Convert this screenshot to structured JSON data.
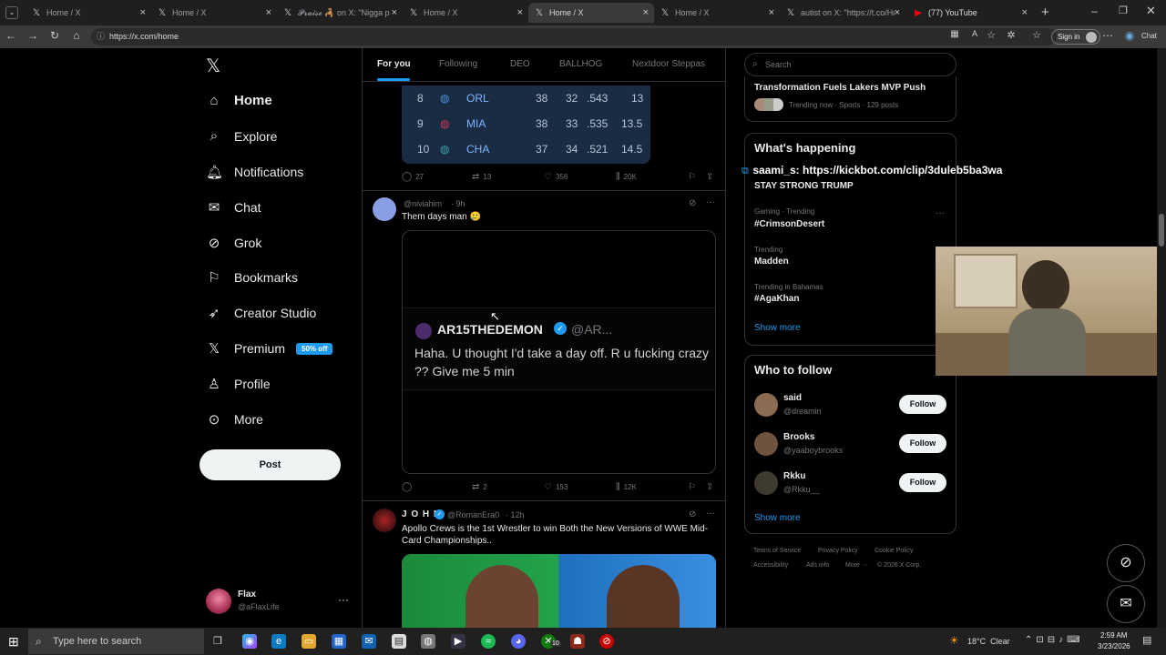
{
  "browser": {
    "tabs": [
      {
        "title": "Home / X",
        "icon": "x-logo-icon"
      },
      {
        "title": "Home / X",
        "icon": "x-logo-icon"
      },
      {
        "title": "𝓟𝓻𝓪𝓲𝓼𝓮 🦂 on X: \"Nigga p",
        "icon": "x-logo-icon"
      },
      {
        "title": "Home / X",
        "icon": "x-logo-icon"
      },
      {
        "title": "Home / X",
        "icon": "x-logo-icon"
      },
      {
        "title": "Home / X",
        "icon": "x-logo-icon"
      },
      {
        "title": "autist on X: \"https://t.co/Hc",
        "icon": "x-logo-icon"
      },
      {
        "title": "(77) YouTube",
        "icon": "youtube-icon"
      }
    ],
    "url": "https://x.com/home",
    "signin_label": "Sign in",
    "chat_label": "Chat"
  },
  "sidebar": {
    "logo": "𝕏",
    "items": [
      {
        "label": "Home",
        "icon": "home-icon"
      },
      {
        "label": "Explore",
        "icon": "search-icon"
      },
      {
        "label": "Notifications",
        "icon": "bell-icon"
      },
      {
        "label": "Chat",
        "icon": "mail-icon"
      },
      {
        "label": "Grok",
        "icon": "grok-icon"
      },
      {
        "label": "Bookmarks",
        "icon": "bookmark-icon"
      },
      {
        "label": "Creator Studio",
        "icon": "rocket-icon"
      },
      {
        "label": "Premium",
        "icon": "x-logo-icon"
      },
      {
        "label": "Profile",
        "icon": "person-icon"
      },
      {
        "label": "More",
        "icon": "more-circle-icon"
      }
    ],
    "premium_badge": "50% off",
    "post_button": "Post",
    "account": {
      "name": "Flax",
      "handle": "@aFlaxLife"
    }
  },
  "feed": {
    "tabs": [
      "For you",
      "Following",
      "DEO",
      "BALLHOG",
      "Nextdoor Steppas"
    ],
    "standings": [
      {
        "rank": "8",
        "team": "ORL",
        "w": "38",
        "l": "32",
        "pct": ".543",
        "gb": "13"
      },
      {
        "rank": "9",
        "team": "MIA",
        "w": "38",
        "l": "33",
        "pct": ".535",
        "gb": "13.5"
      },
      {
        "rank": "10",
        "team": "CHA",
        "w": "37",
        "l": "34",
        "pct": ".521",
        "gb": "14.5"
      }
    ],
    "post1_actions": {
      "replies": "27",
      "reposts": "13",
      "likes": "356",
      "views": "20K"
    },
    "post2": {
      "handle": "@niviahim",
      "time": "· 9h",
      "text": "Them days man 🥲",
      "quote_name": "AR15THEDEMON",
      "quote_handle": "@AR...",
      "quote_text": "Haha. U thought I'd take a day off. R u fucking crazy ?? Give me 5 min",
      "replies": "",
      "reposts": "2",
      "likes": "153",
      "views": "12K"
    },
    "post3": {
      "name": "J O H N",
      "handle": "@RomanEra0",
      "time": "· 12h",
      "text": "Apollo Crews is the 1st Wrestler to win Both the New Versions of WWE Mid-Card Championships.."
    }
  },
  "right": {
    "search_placeholder": "Search",
    "top_trend_title": "Transformation Fuels Lakers MVP Push",
    "top_trend_meta": "Trending now · Sports · 129 posts",
    "happening_title": "What's happening",
    "overlay_text": "saami_s: https://kickbot.com/clip/3duleb5ba3wa",
    "trends": [
      {
        "meta": "",
        "name": "STAY STRONG TRUMP"
      },
      {
        "meta": "Gaming · Trending",
        "name": "#CrimsonDesert"
      },
      {
        "meta": "Trending",
        "name": "Madden"
      },
      {
        "meta": "Trending in Bahamas",
        "name": "#AgaKhan"
      }
    ],
    "show_more": "Show more",
    "who_to_follow": "Who to follow",
    "follow_suggestions": [
      {
        "name": "said",
        "handle": "@dreamin"
      },
      {
        "name": "Brooks",
        "handle": "@yaaboybrooks"
      },
      {
        "name": "Rkku",
        "handle": "@Rkku__"
      }
    ],
    "follow_label": "Follow",
    "footer": [
      "Terms of Service",
      "Privacy Policy",
      "Cookie Policy",
      "Accessibility",
      "Ads info",
      "More ···",
      "© 2026 X Corp."
    ]
  },
  "taskbar": {
    "search_placeholder": "Type here to search",
    "weather": "18°C  Clear",
    "time": "2:59 AM",
    "date": "3/23/2026",
    "badge": "10"
  }
}
